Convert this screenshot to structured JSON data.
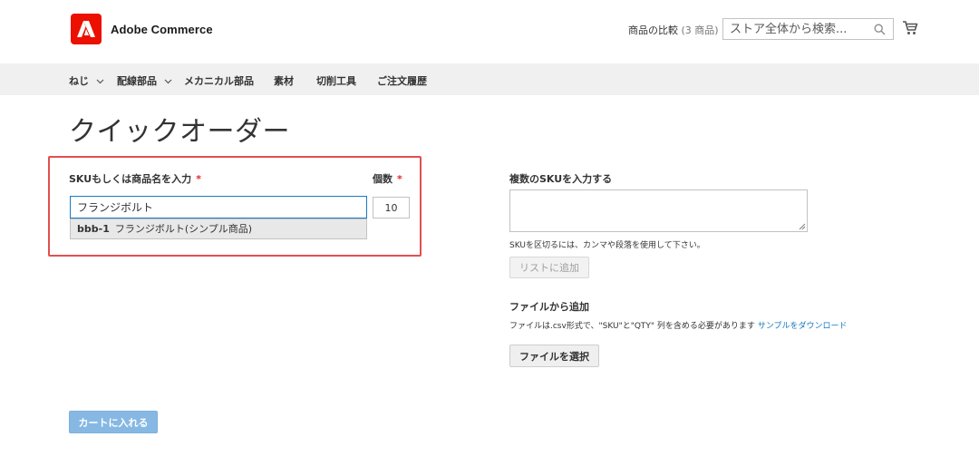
{
  "header": {
    "logo_text": "Adobe Commerce",
    "compare_label": "商品の比較",
    "compare_count": "(3 商品)",
    "search_placeholder": "ストア全体から検索...",
    "brand_color": "#eb1000"
  },
  "nav": {
    "items": [
      {
        "label": "ねじ",
        "has_dropdown": true
      },
      {
        "label": "配線部品",
        "has_dropdown": true
      },
      {
        "label": "メカニカル部品",
        "has_dropdown": false
      },
      {
        "label": "素材",
        "has_dropdown": false
      },
      {
        "label": "切削工具",
        "has_dropdown": false
      },
      {
        "label": "ご注文履歴",
        "has_dropdown": false
      }
    ]
  },
  "page": {
    "title": "クイックオーダー"
  },
  "left_panel": {
    "sku_label": "SKUもしくは商品名を入力",
    "required_mark": "*",
    "qty_label": "個数",
    "sku_value": "フランジボルト",
    "qty_value": "10",
    "suggestion": {
      "sku": "bbb-1",
      "name": "フランジボルト(シンプル商品)"
    },
    "add_to_cart_label": "カートに入れる"
  },
  "right_panel": {
    "multi_sku_label": "複数のSKUを入力する",
    "multi_sku_hint": "SKUを区切るには、カンマや段落を使用して下さい。",
    "add_to_list_label": "リストに追加",
    "file_section_label": "ファイルから追加",
    "file_hint": "ファイルは.csv形式で、\"SKU\"と\"QTY\" 列を含める必要があります",
    "sample_link": "サンプルをダウンロード",
    "choose_file_label": "ファイルを選択"
  }
}
